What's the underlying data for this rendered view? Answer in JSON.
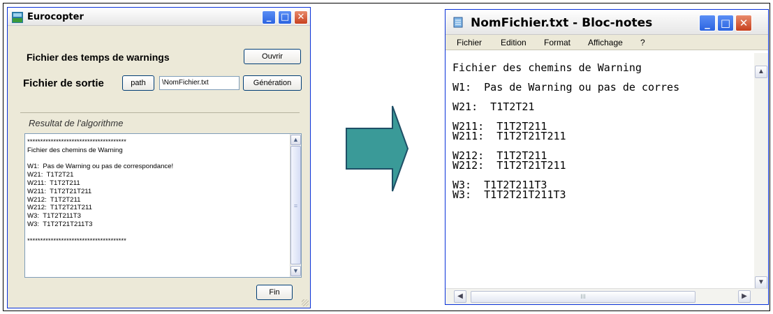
{
  "app": {
    "title": "Eurocopter",
    "buttons": {
      "minimize": "_",
      "maximize": "□",
      "close": "✕"
    },
    "warnings_label": "Fichier des temps de warnings",
    "open_button": "Ouvrir",
    "output_label": "Fichier de sortie",
    "path_button": "path",
    "output_field_value": "\\NomFichier.txt",
    "generate_button": "Génération",
    "result_label": "Resultat de l'algorithme",
    "result_lines": [
      "**************************************",
      "Fichier des chemins de Warning",
      "",
      "W1:  Pas de Warning ou pas de correspondance!",
      "W21:  T1T2T21",
      "W211:  T1T2T211",
      "W211:  T1T2T21T211",
      "W212:  T1T2T211",
      "W212:  T1T2T21T211",
      "W3:  T1T2T211T3",
      "W3:  T1T2T21T211T3",
      "",
      "**************************************"
    ],
    "end_button": "Fin"
  },
  "notepad": {
    "title": "NomFichier.txt - Bloc-notes",
    "menu": [
      "Fichier",
      "Edition",
      "Format",
      "Affichage",
      "?"
    ],
    "lines": [
      "Fichier des chemins de Warning",
      "",
      "W1:  Pas de Warning ou pas de corres",
      "",
      "W21:  T1T2T21",
      "",
      "W211:  T1T2T211",
      "W211:  T1T2T21T211",
      "",
      "W212:  T1T2T211",
      "W212:  T1T2T21T211",
      "",
      "W3:  T1T2T211T3",
      "W3:  T1T2T21T211T3"
    ],
    "hscroll_thumb": "III"
  },
  "colors": {
    "arrow_fill": "#3a9a98",
    "arrow_stroke": "#1f4f66",
    "xp_blue": "#2b63e0",
    "xp_close": "#c7401e"
  }
}
